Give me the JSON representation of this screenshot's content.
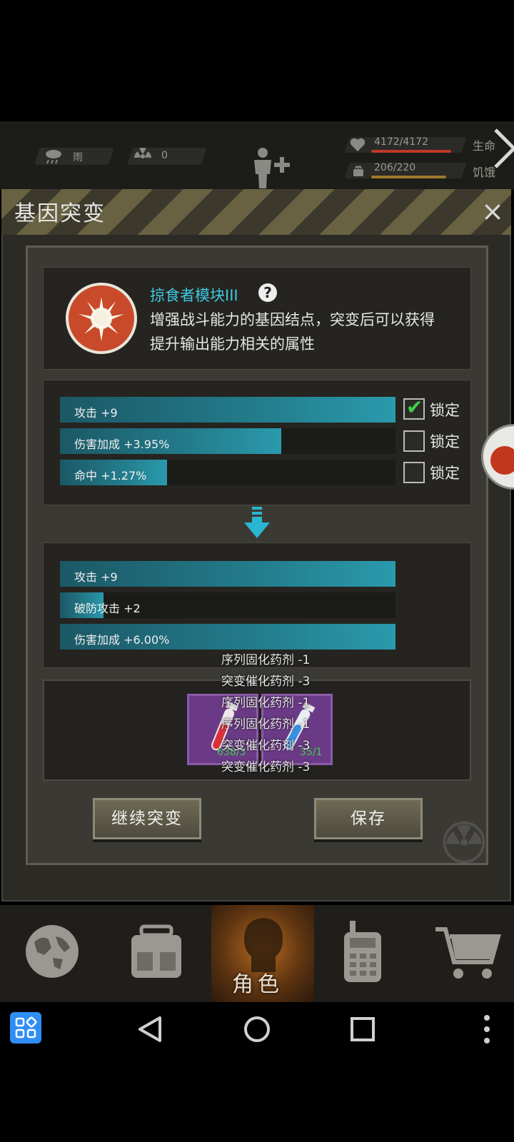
{
  "status": {
    "weather": "雨",
    "radiation": "0",
    "hp_value": "4172/4172",
    "hp_label": "生命",
    "hp_ratio": 1.0,
    "hunger_value": "206/220",
    "hunger_label": "饥饿",
    "hunger_ratio": 0.936
  },
  "dialog": {
    "title": "基因突变",
    "close": "×"
  },
  "module": {
    "name": "掠食者模块III",
    "help": "?",
    "desc_line1": "增强战斗能力的基因结点，突变后可以获得",
    "desc_line2": "提升输出能力相关的属性"
  },
  "current_attrs": [
    {
      "label": "攻击 +9",
      "fill": 1.0,
      "locked": true,
      "lock_label": "锁定"
    },
    {
      "label": "伤害加成 +3.95%",
      "fill": 0.66,
      "locked": false,
      "lock_label": "锁定"
    },
    {
      "label": "命中 +1.27%",
      "fill": 0.32,
      "locked": false,
      "lock_label": "锁定"
    }
  ],
  "new_attrs": [
    {
      "label": "攻击 +9",
      "fill": 1.0
    },
    {
      "label": "破防攻击 +2",
      "fill": 0.13
    },
    {
      "label": "伤害加成 +6.00%",
      "fill": 1.0
    }
  ],
  "items": [
    {
      "name": "red-vial",
      "count": "638/3",
      "color": "#d8313a"
    },
    {
      "name": "blue-vial",
      "count": "35/1",
      "color": "#3a8fe0"
    }
  ],
  "floating_texts": [
    "序列固化药剂 -1",
    "突变催化药剂 -3",
    "序列固化药剂 -1",
    "序列固化药剂 -1",
    "突变催化药剂 -3",
    "突变催化药剂 -3"
  ],
  "buttons": {
    "continue": "继续突变",
    "save": "保存"
  },
  "nav": {
    "active_label": "角色"
  }
}
